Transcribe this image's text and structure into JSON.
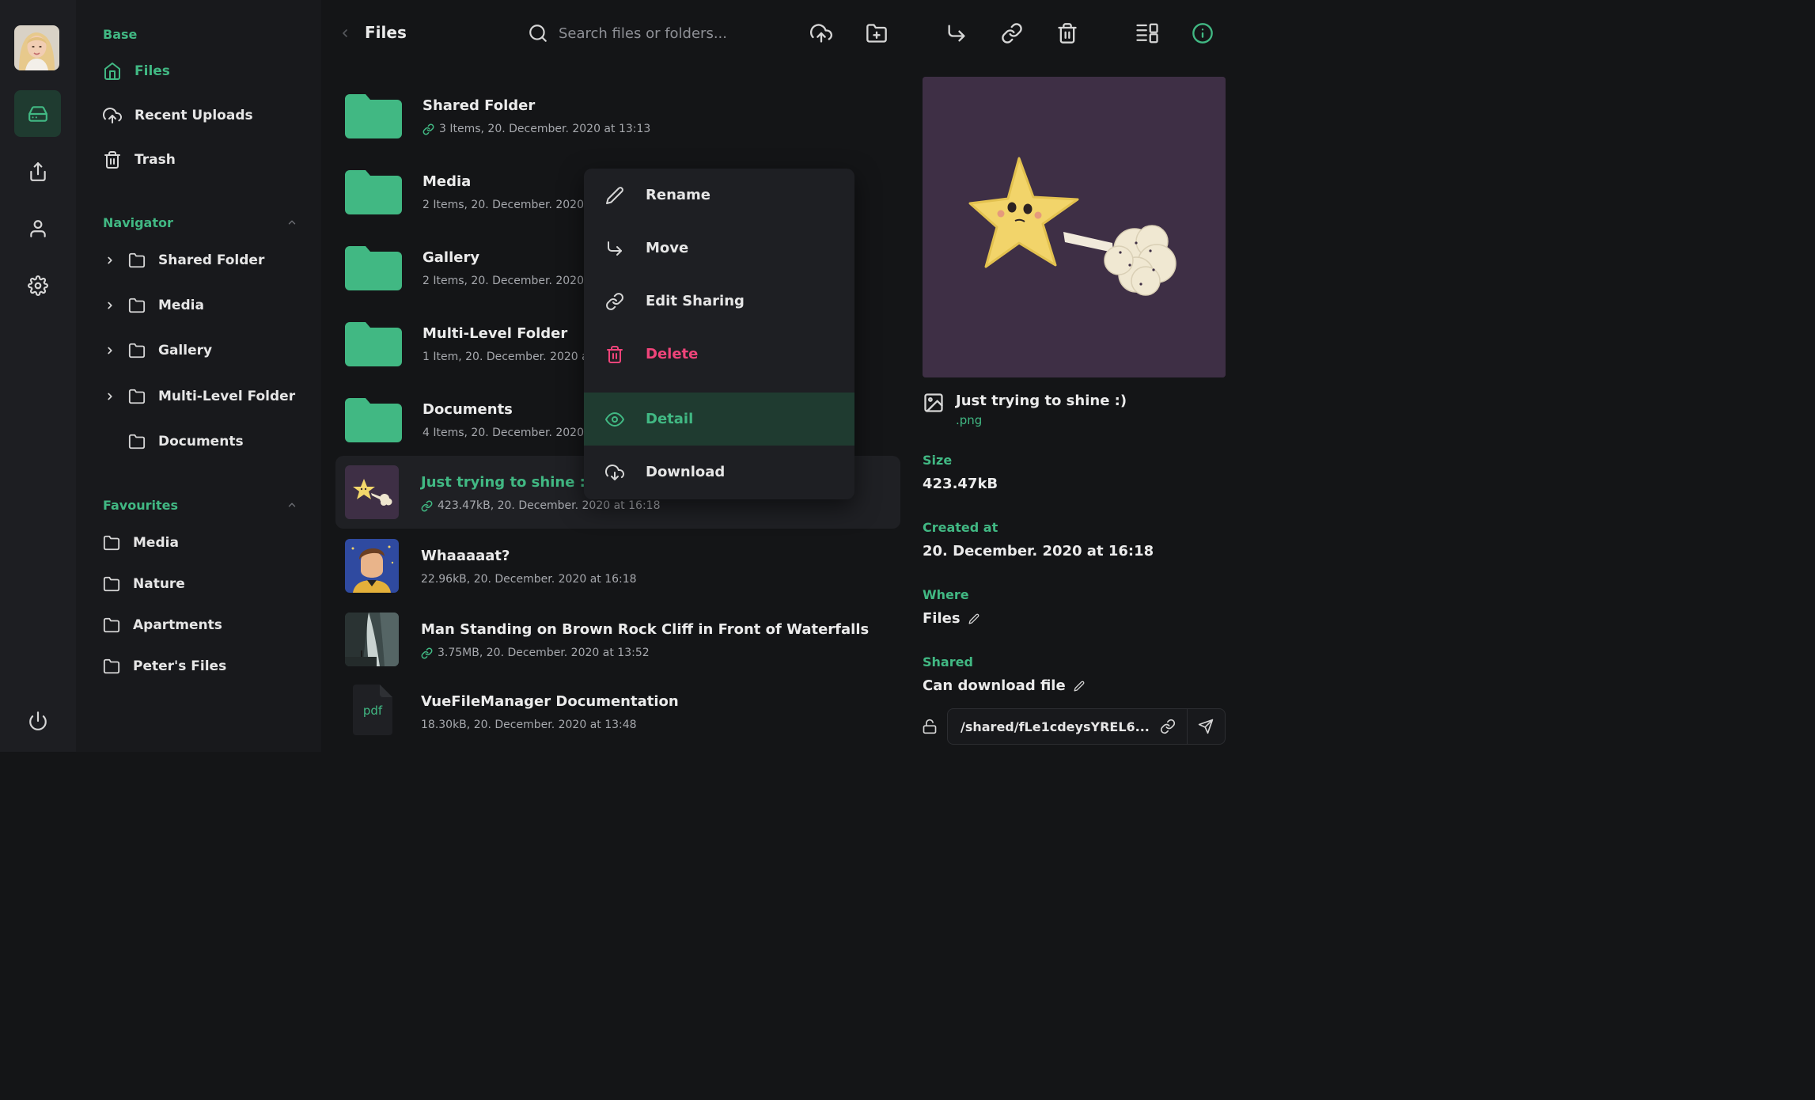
{
  "rail": {
    "items": [
      "drive-icon",
      "share-icon",
      "user-icon",
      "settings-icon"
    ],
    "power": "power-icon"
  },
  "nav": {
    "base_title": "Base",
    "base_items": [
      {
        "label": "Files",
        "icon": "home-icon"
      },
      {
        "label": "Recent Uploads",
        "icon": "cloud-upload-icon"
      },
      {
        "label": "Trash",
        "icon": "trash-icon"
      }
    ],
    "navigator_title": "Navigator",
    "navigator_items": [
      "Shared Folder",
      "Media",
      "Gallery",
      "Multi-Level Folder",
      "Documents"
    ],
    "favourites_title": "Favourites",
    "favourites_items": [
      "Media",
      "Nature",
      "Apartments",
      "Peter's Files"
    ]
  },
  "topbar": {
    "title": "Files",
    "search_placeholder": "Search files or folders..."
  },
  "files": [
    {
      "name": "Shared Folder",
      "meta": "3 Items, 20. December. 2020 at 13:13",
      "shared": true
    },
    {
      "name": "Media",
      "meta": "2 Items, 20. December. 2020 at 13:13",
      "shared": false
    },
    {
      "name": "Gallery",
      "meta": "2 Items, 20. December. 2020 at 13:13",
      "shared": false
    },
    {
      "name": "Multi-Level Folder",
      "meta": "1 Item, 20. December. 2020 at 13:13",
      "shared": false
    },
    {
      "name": "Documents",
      "meta": "4 Items, 20. December. 2020 at 13:13",
      "shared": false
    },
    {
      "name": "Just trying to shine :)",
      "meta": "423.47kB, 20. December. 2020 at 16:18",
      "shared": true,
      "selected": true
    },
    {
      "name": "Whaaaaat?",
      "meta": "22.96kB, 20. December. 2020 at 16:18",
      "shared": false
    },
    {
      "name": "Man Standing on Brown Rock Cliff in Front of Waterfalls",
      "meta": "3.75MB, 20. December. 2020 at 13:52",
      "shared": true
    },
    {
      "name": "VueFileManager Documentation",
      "meta": "18.30kB, 20. December. 2020 at 13:48",
      "shared": false,
      "ext": "pdf"
    }
  ],
  "context_menu": [
    "Rename",
    "Move",
    "Edit Sharing",
    "Delete",
    "Detail",
    "Download"
  ],
  "detail": {
    "name": "Just trying to shine :)",
    "ext": ".png",
    "size_label": "Size",
    "size": "423.47kB",
    "created_label": "Created at",
    "created": "20. December. 2020 at 16:18",
    "where_label": "Where",
    "where": "Files",
    "shared_label": "Shared",
    "shared": "Can download file",
    "share_url": "/shared/fLe1cdeysYREL6..."
  },
  "colors": {
    "accent": "#41b883",
    "danger": "#f0447a",
    "background": "#141517"
  }
}
